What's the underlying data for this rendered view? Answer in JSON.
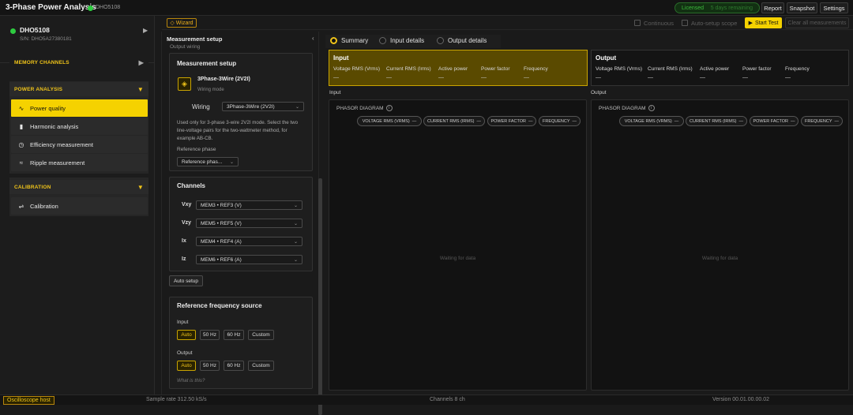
{
  "app": {
    "title": "3-Phase Power Analysis",
    "connection_name": "DHO5108",
    "license_status": "Licensed",
    "license_days": "5 days remaining",
    "report_label": "Report",
    "snapshot_label": "Snapshot",
    "settings_label": "Settings"
  },
  "toolbar": {
    "wizard_label": "Wizard",
    "continuous_label": "Continuous",
    "autosetup_scope_label": "Auto-setup scope",
    "start_label": "Start Test",
    "clear_label": "Clear all measurements"
  },
  "sidebar": {
    "device_name": "DHO5108",
    "device_sn": "S/N: DHO5A27380181",
    "memory_channels": "MEMORY CHANNELS",
    "power_analysis": "POWER ANALYSIS",
    "items": [
      {
        "label": "Power quality",
        "icon": "waveform-icon"
      },
      {
        "label": "Harmonic analysis",
        "icon": "bars-icon"
      },
      {
        "label": "Efficiency measurement",
        "icon": "clock-icon"
      },
      {
        "label": "Ripple measurement",
        "icon": "ripple-icon"
      }
    ],
    "calibration": "CALIBRATION",
    "calibration_item": "Calibration"
  },
  "setup": {
    "panel_title": "Measurement setup",
    "scroll_hint": "Output wiring",
    "card_title": "Measurement setup",
    "wiring_name": "3Phase-3Wire (2V2I)",
    "wiring_mode": "Wiring mode",
    "wiring_label": "Wiring",
    "wiring_value": "3Phase-3Wire (2V2I)",
    "description": "Used only for 3-phase 3-wire 2V2I mode. Select the two line-voltage pairs for the two-wattmeter method, for example AB-CB.",
    "ref_phase_label": "Reference phase",
    "ref_phase_value": "Reference phas..."
  },
  "channels": {
    "title": "Channels",
    "rows": [
      {
        "label": "Vxy",
        "value": "MEM3 • REF3 (V)"
      },
      {
        "label": "Vzy",
        "value": "MEM5 • REF5 (V)"
      },
      {
        "label": "Ix",
        "value": "MEM4 • REF4 (A)"
      },
      {
        "label": "Iz",
        "value": "MEM6 • REF6 (A)"
      }
    ],
    "auto_setup": "Auto setup"
  },
  "ref_freq": {
    "title": "Reference frequency source",
    "input_label": "Input",
    "output_label": "Output",
    "options": [
      "Auto",
      "50 Hz",
      "60 Hz",
      "Custom"
    ],
    "selected": "Auto",
    "help": "What is this?"
  },
  "results": {
    "tabs": [
      "Summary",
      "Input details",
      "Output details"
    ],
    "selected_tab": "Summary",
    "input_title": "Input",
    "output_title": "Output",
    "metric_labels": [
      "Voltage RMS (Vrms)",
      "Current RMS (Irms)",
      "Active power",
      "Power factor",
      "Frequency"
    ],
    "metric_value": "—",
    "input_section": "Input",
    "output_section": "Output",
    "phasor_title": "PHASOR DIAGRAM",
    "chips": [
      "VOLTAGE RMS (VRMS)",
      "CURRENT RMS (IRMS)",
      "POWER FACTOR",
      "FREQUENCY"
    ],
    "waiting": "Waiting for data"
  },
  "status": {
    "osc_host": "Oscilloscope host",
    "sample_rate": "Sample rate 312.50 kS/s",
    "channels": "Channels 8 ch",
    "version": "Version 00.01.00.00.02"
  },
  "colors": {
    "accent": "#f5d200",
    "online": "#2ecc40",
    "input_box": "#5a4a00"
  }
}
